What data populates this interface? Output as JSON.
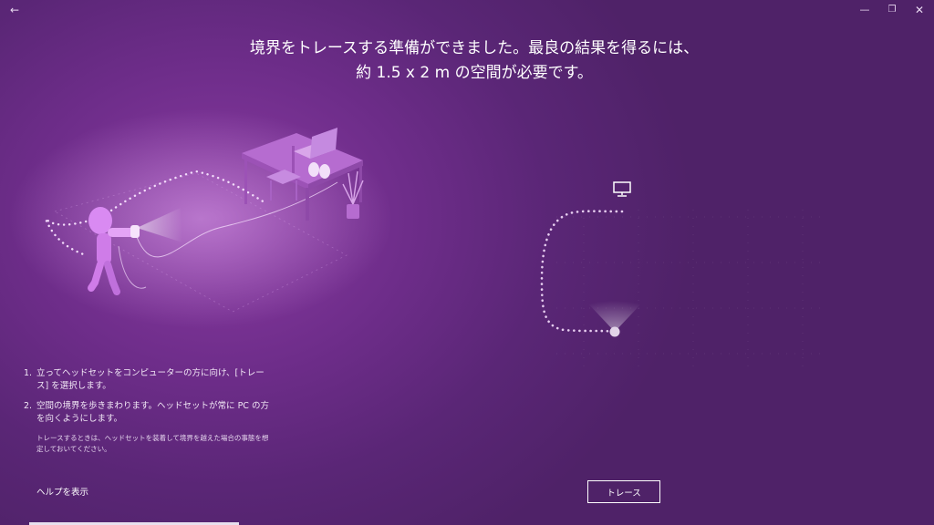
{
  "titlebar": {
    "back_glyph": "←",
    "minimize_glyph": "—",
    "maximize_glyph": "❐",
    "close_glyph": "✕"
  },
  "headline": {
    "line1": "境界をトレースする準備ができました。最良の結果を得るには、",
    "line2": "約 1.5 x 2 m の空間が必要です。"
  },
  "steps": [
    {
      "num": "1.",
      "text": "立ってヘッドセットをコンピューターの方に向け、[トレース] を選択します。"
    },
    {
      "num": "2.",
      "text": "空間の境界を歩きまわります。ヘッドセットが常に PC の方を向くようにします。"
    }
  ],
  "note": "トレースするときは、ヘッドセットを装着して境界を越えた場合の事態を想定しておいてください。",
  "help_link": "ヘルプを表示",
  "trace_button": "トレース",
  "icons": {
    "back": "back-arrow-icon",
    "monitor": "monitor-icon",
    "headset_position": "headset-position-dot"
  },
  "colors": {
    "background": "#6e2d8a",
    "accent": "#c87fe0",
    "text": "#ffffff"
  }
}
